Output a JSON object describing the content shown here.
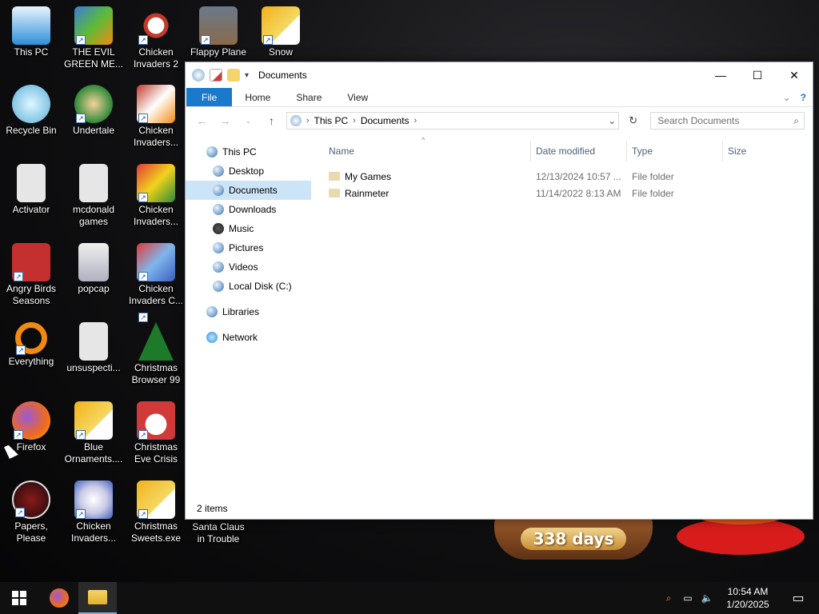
{
  "desktop": {
    "icons": [
      {
        "label": "This PC",
        "icon": "this-pc-icon",
        "color": "#2d8fd9"
      },
      {
        "label": "THE EVIL GREEN ME...",
        "icon": "messenger-icon",
        "color": "#3b7bd8"
      },
      {
        "label": "Chicken Invaders 2",
        "icon": "chicken-icon",
        "color": "#c33a2a"
      },
      {
        "label": "Flappy Plane",
        "icon": "flappy-plane-icon",
        "color": "#8a6a4a"
      },
      {
        "label": "Snow",
        "icon": "file-icon",
        "color": "#f2b11c"
      },
      {
        "label": "Recycle Bin",
        "icon": "recycle-bin-icon",
        "color": "#5ab0d8"
      },
      {
        "label": "Undertale",
        "icon": "undertale-icon",
        "color": "#2f8a3a"
      },
      {
        "label": "Chicken Invaders...",
        "icon": "chicken-icon",
        "color": "#d9d9d9"
      },
      {
        "label": "Activator",
        "icon": "file-icon",
        "color": "#e6e6e6"
      },
      {
        "label": "mcdonald games",
        "icon": "file-icon",
        "color": "#e6e6e6"
      },
      {
        "label": "Chicken Invaders...",
        "icon": "chicken-icon",
        "color": "#e03a3a"
      },
      {
        "label": "Angry Birds Seasons",
        "icon": "angry-birds-icon",
        "color": "#c43030"
      },
      {
        "label": "popcap",
        "icon": "popcap-icon",
        "color": "#e6e6e6"
      },
      {
        "label": "Chicken Invaders C...",
        "icon": "chicken-icon",
        "color": "#3b5ec0"
      },
      {
        "label": "Everything",
        "icon": "everything-search-icon",
        "color": "#f28a10"
      },
      {
        "label": "unsuspecti...",
        "icon": "file-icon",
        "color": "#e6e6e6"
      },
      {
        "label": "Christmas Browser 99",
        "icon": "christmas-tree-icon",
        "color": "#1d7a2a"
      },
      {
        "label": "Firefox",
        "icon": "firefox-icon",
        "color": "#f06a1a"
      },
      {
        "label": "Blue Ornaments....",
        "icon": "file-icon",
        "color": "#f2b11c"
      },
      {
        "label": "Christmas Eve Crisis",
        "icon": "santa-icon",
        "color": "#d23a3a"
      },
      {
        "label": "Papers, Please",
        "icon": "papers-please-icon",
        "color": "#8b1a1a"
      },
      {
        "label": "Chicken Invaders...",
        "icon": "chicken-icon",
        "color": "#c9c9e6"
      },
      {
        "label": "Christmas Sweets.exe",
        "icon": "file-icon",
        "color": "#f2b11c"
      },
      {
        "label": "Santa Claus in Trouble",
        "icon": "",
        "color": ""
      }
    ]
  },
  "explorer": {
    "title": "Documents",
    "ribbon_tabs": [
      "File",
      "Home",
      "Share",
      "View"
    ],
    "address": {
      "root": "This PC",
      "current": "Documents"
    },
    "search_placeholder": "Search Documents",
    "nav": [
      {
        "label": "This PC",
        "level": 0
      },
      {
        "label": "Desktop",
        "level": 1
      },
      {
        "label": "Documents",
        "level": 1,
        "selected": true
      },
      {
        "label": "Downloads",
        "level": 1
      },
      {
        "label": "Music",
        "level": 1
      },
      {
        "label": "Pictures",
        "level": 1
      },
      {
        "label": "Videos",
        "level": 1
      },
      {
        "label": "Local Disk (C:)",
        "level": 1
      },
      {
        "label": "Libraries",
        "level": 0
      },
      {
        "label": "Network",
        "level": 0
      }
    ],
    "columns": {
      "name": "Name",
      "date": "Date modified",
      "type": "Type",
      "size": "Size"
    },
    "files": [
      {
        "name": "My Games",
        "date": "12/13/2024 10:57 ...",
        "type": "File folder",
        "size": ""
      },
      {
        "name": "Rainmeter",
        "date": "11/14/2022 8:13 AM",
        "type": "File folder",
        "size": ""
      }
    ],
    "status": "2 items",
    "accent": "#1979ca"
  },
  "gadget": {
    "countdown": "338 days"
  },
  "taskbar": {
    "time": "10:54 AM",
    "date": "1/20/2025"
  }
}
